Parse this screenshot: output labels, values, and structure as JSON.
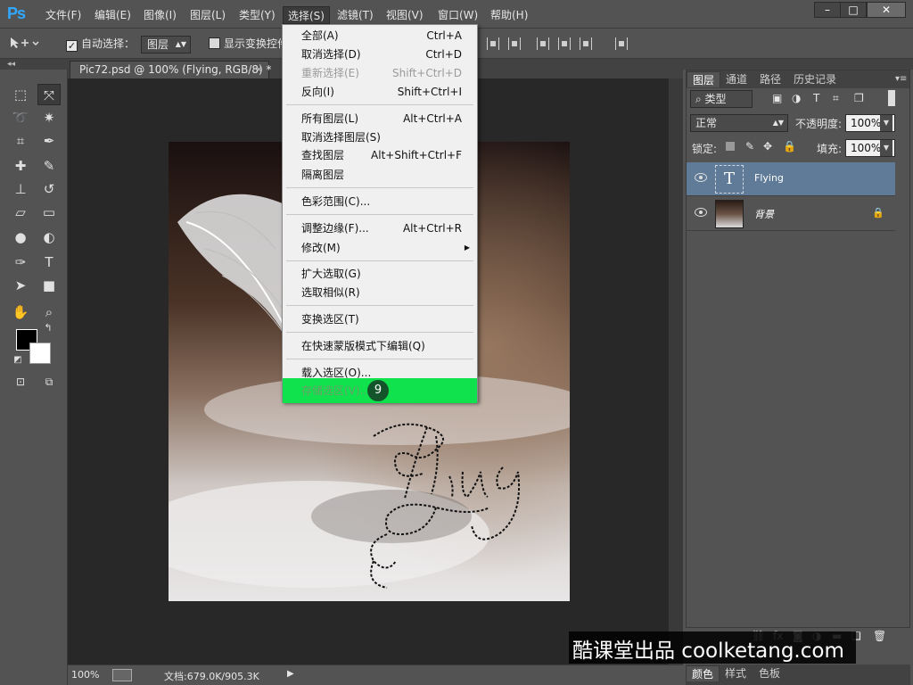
{
  "app": {
    "logo": "Ps"
  },
  "menubar": {
    "items": [
      "文件(F)",
      "编辑(E)",
      "图像(I)",
      "图层(L)",
      "类型(Y)",
      "选择(S)",
      "滤镜(T)",
      "视图(V)",
      "窗口(W)",
      "帮助(H)"
    ],
    "active": "选择(S)"
  },
  "window_controls": {
    "minimize": "–",
    "maximize": "□",
    "close": "✕"
  },
  "options": {
    "auto_select_label": "自动选择：",
    "auto_select_target": "图层",
    "show_transform_label": "显示变换控件"
  },
  "document": {
    "tab_title": "Pic72.psd @ 100% (Flying, RGB/8) *",
    "tab_close": "×",
    "zoom": "100%",
    "doc_size": "文档:679.0K/905.3K"
  },
  "select_menu": {
    "groups": [
      [
        {
          "label": "全部(A)",
          "shortcut": "Ctrl+A"
        },
        {
          "label": "取消选择(D)",
          "shortcut": "Ctrl+D"
        },
        {
          "label": "重新选择(E)",
          "shortcut": "Shift+Ctrl+D",
          "disabled": true
        },
        {
          "label": "反向(I)",
          "shortcut": "Shift+Ctrl+I"
        }
      ],
      [
        {
          "label": "所有图层(L)",
          "shortcut": "Alt+Ctrl+A"
        },
        {
          "label": "取消选择图层(S)",
          "shortcut": ""
        },
        {
          "label": "查找图层",
          "shortcut": "Alt+Shift+Ctrl+F"
        },
        {
          "label": "隔离图层",
          "shortcut": ""
        }
      ],
      [
        {
          "label": "色彩范围(C)...",
          "shortcut": ""
        }
      ],
      [
        {
          "label": "调整边缘(F)...",
          "shortcut": "Alt+Ctrl+R"
        },
        {
          "label": "修改(M)",
          "shortcut": "",
          "submenu": true
        }
      ],
      [
        {
          "label": "扩大选取(G)",
          "shortcut": ""
        },
        {
          "label": "选取相似(R)",
          "shortcut": ""
        }
      ],
      [
        {
          "label": "变换选区(T)",
          "shortcut": ""
        }
      ],
      [
        {
          "label": "在快速蒙版模式下编辑(Q)",
          "shortcut": ""
        }
      ],
      [
        {
          "label": "载入选区(O)...",
          "shortcut": ""
        },
        {
          "label": "存储选区(V)...",
          "shortcut": "",
          "highlighted": true
        }
      ]
    ],
    "step_badge": "9",
    "highlight_color": "#0fe24c"
  },
  "layers_panel": {
    "tabs": [
      "图层",
      "通道",
      "路径",
      "历史记录"
    ],
    "filter_kind": "类型",
    "blend_mode": "正常",
    "opacity_label": "不透明度:",
    "opacity_value": "100%",
    "lock_label": "锁定:",
    "fill_label": "填充:",
    "fill_value": "100%",
    "layers": [
      {
        "name": "Flying",
        "type": "text",
        "selected": true
      },
      {
        "name": "背景",
        "type": "image",
        "selected": false,
        "locked": true
      }
    ]
  },
  "bottom_tabs": [
    "颜色",
    "样式",
    "色板"
  ],
  "watermark": "酷课堂出品 coolketang.com",
  "canvas_text": "Flying"
}
